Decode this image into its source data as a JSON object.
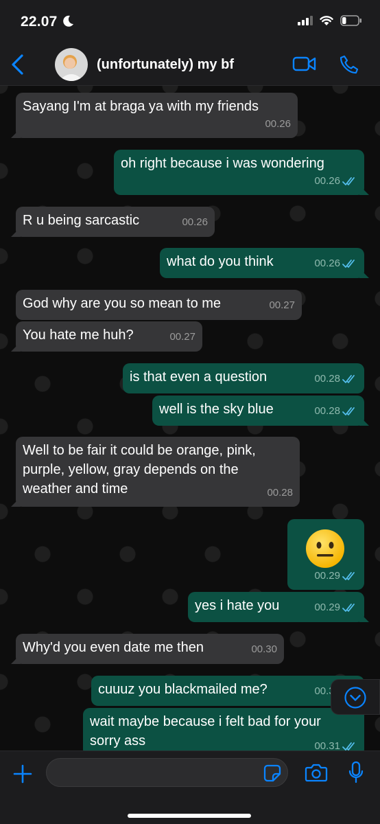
{
  "status_bar": {
    "time": "22.07",
    "battery_level": 0.25
  },
  "header": {
    "contact_name": "(unfortunately) my bf"
  },
  "messages": [
    {
      "dir": "in",
      "text": "Sayang I'm at braga ya with my friends",
      "time": "00.26"
    },
    {
      "dir": "out",
      "text": "oh right because i was wondering",
      "time": "00.26",
      "ticks": "read"
    },
    {
      "dir": "in",
      "text": "R u being sarcastic",
      "time": "00.26"
    },
    {
      "dir": "out",
      "text": "what do you think",
      "time": "00.26",
      "ticks": "read"
    },
    {
      "dir": "in",
      "text": "God why are you so mean to me",
      "time": "00.27"
    },
    {
      "dir": "in",
      "text": "You hate me huh?",
      "time": "00.27"
    },
    {
      "dir": "out",
      "text": "is that even a question",
      "time": "00.28",
      "ticks": "read"
    },
    {
      "dir": "out",
      "text": "well is the sky blue",
      "time": "00.28",
      "ticks": "read"
    },
    {
      "dir": "in",
      "text": "Well to be fair it could be orange, pink, purple, yellow, gray depends on the weather and time",
      "time": "00.28"
    },
    {
      "dir": "out",
      "emoji": "neutral-face",
      "time": "00.29",
      "ticks": "read"
    },
    {
      "dir": "out",
      "text": "yes i hate you",
      "time": "00.29",
      "ticks": "read"
    },
    {
      "dir": "in",
      "text": "Why'd you even date me then",
      "time": "00.30"
    },
    {
      "dir": "out",
      "text": "cuuuz you blackmailed me?",
      "time": "00.31",
      "ticks": "read"
    },
    {
      "dir": "out",
      "text": "wait maybe because i felt bad for your sorry ass",
      "time": "00.31",
      "ticks": "read"
    }
  ],
  "composer": {
    "placeholder": ""
  },
  "colors": {
    "incoming_bubble": "#363638",
    "outgoing_bubble": "#0c5143",
    "accent_blue": "#0a84ff",
    "read_tick": "#53bdeb"
  },
  "icons": {
    "back": "chevron-left-icon",
    "video": "video-camera-icon",
    "call": "phone-icon",
    "scroll": "chevron-down-circle-icon",
    "attach": "plus-icon",
    "sticker": "sticker-icon",
    "camera": "camera-icon",
    "mic": "microphone-icon"
  }
}
